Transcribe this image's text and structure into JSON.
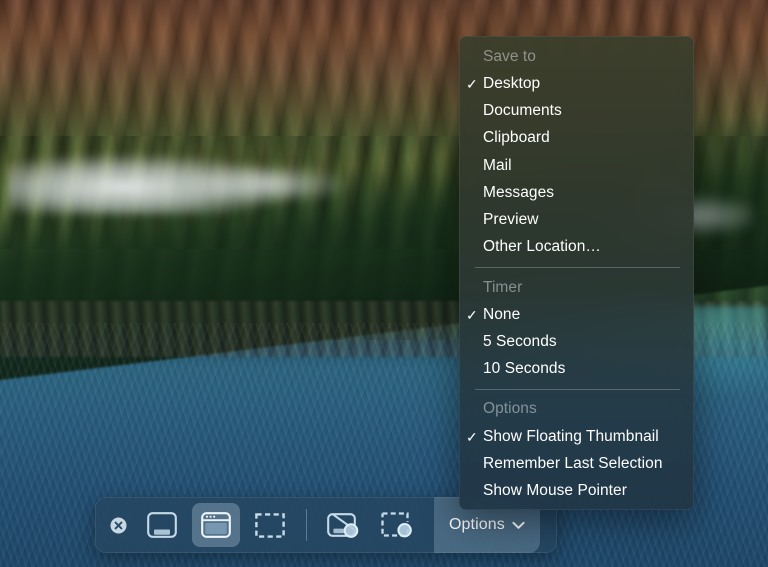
{
  "desktop": {
    "wallpaper_name": "big-sur-coastline",
    "colors": {
      "mountain_brown": "#6b4430",
      "hill_green": "#3f5a2c",
      "ocean_blue": "#26577a",
      "shallow_teal": "#5ac8d2"
    }
  },
  "toolbar": {
    "name": "screenshot-toolbar",
    "close_label": "✕",
    "buttons": [
      {
        "id": "capture-entire-screen",
        "label": "Capture Entire Screen",
        "icon": "screen-icon",
        "selected": false
      },
      {
        "id": "capture-selected-window",
        "label": "Capture Selected Window",
        "icon": "window-icon",
        "selected": true
      },
      {
        "id": "capture-selected-portion",
        "label": "Capture Selected Portion",
        "icon": "selection-icon",
        "selected": false
      },
      {
        "id": "record-entire-screen",
        "label": "Record Entire Screen",
        "icon": "record-screen-icon",
        "selected": false
      },
      {
        "id": "record-selected-portion",
        "label": "Record Selected Portion",
        "icon": "record-selection-icon",
        "selected": false
      }
    ],
    "options_label": "Options",
    "options_chevron": "chevron-down-icon"
  },
  "menu": {
    "sections": [
      {
        "header": "Save to",
        "items": [
          {
            "label": "Desktop",
            "checked": true
          },
          {
            "label": "Documents",
            "checked": false
          },
          {
            "label": "Clipboard",
            "checked": false
          },
          {
            "label": "Mail",
            "checked": false
          },
          {
            "label": "Messages",
            "checked": false
          },
          {
            "label": "Preview",
            "checked": false
          },
          {
            "label": "Other Location…",
            "checked": false
          }
        ]
      },
      {
        "header": "Timer",
        "items": [
          {
            "label": "None",
            "checked": true
          },
          {
            "label": "5 Seconds",
            "checked": false
          },
          {
            "label": "10 Seconds",
            "checked": false
          }
        ]
      },
      {
        "header": "Options",
        "items": [
          {
            "label": "Show Floating Thumbnail",
            "checked": true
          },
          {
            "label": "Remember Last Selection",
            "checked": false
          },
          {
            "label": "Show Mouse Pointer",
            "checked": false
          }
        ]
      }
    ],
    "check_glyph": "✓"
  }
}
